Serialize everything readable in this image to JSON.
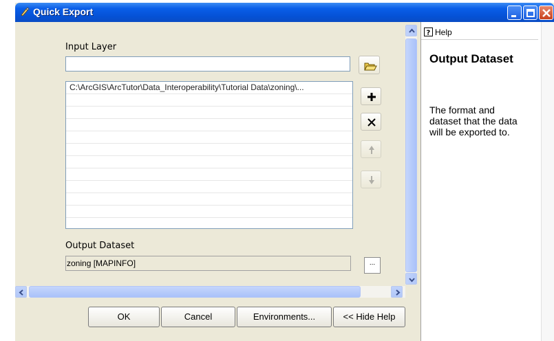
{
  "window": {
    "title": "Quick Export",
    "title_icon": "pencil-wrench-icon",
    "titlebar_color": "#0a5ee8"
  },
  "form": {
    "input_layer_label": "Input Layer",
    "input_layer_value": "",
    "input_list": [
      "C:\\ArcGIS\\ArcTutor\\Data_Interoperability\\Tutorial Data\\zoning\\...",
      "",
      "",
      "",
      "",
      "",
      "",
      "",
      "",
      "",
      "",
      ""
    ],
    "output_label": "Output Dataset",
    "output_value": "zoning [MAPINFO]",
    "browse_label": "..."
  },
  "buttons": {
    "ok": "OK",
    "cancel": "Cancel",
    "environments": "Environments...",
    "hide_help": "<< Hide Help"
  },
  "help": {
    "tab_label": "Help",
    "title": "Output Dataset",
    "body": "The format and dataset that the data will be exported to."
  },
  "side_icons": [
    "open-folder-icon",
    "add-icon",
    "remove-icon",
    "move-up-icon",
    "move-down-icon"
  ]
}
